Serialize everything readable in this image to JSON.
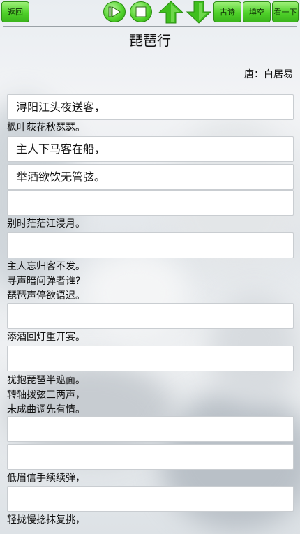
{
  "toolbar": {
    "back_label": "返回",
    "play_icon": "play-icon",
    "stop_icon": "stop-icon",
    "up_icon": "arrow-up-icon",
    "down_icon": "arrow-down-icon",
    "ancient_poem_label": "古诗",
    "fill_blank_label": "填空",
    "next_label": "看一下"
  },
  "poem": {
    "title": "琵琶行",
    "author": "唐：白居易"
  },
  "boxes": [
    "浔阳江头夜送客，",
    "主人下马客在船，",
    "举酒欲饮无管弦。",
    "",
    "",
    "",
    "",
    "",
    "",
    "",
    ""
  ],
  "lines": [
    "枫叶荻花秋瑟瑟。",
    "别时茫茫江浸月。",
    "主人忘归客不发。",
    "寻声暗问弹者谁?",
    "琵琶声停欲语迟。",
    "添酒回灯重开宴。",
    "犹抱琵琶半遮面。",
    "转轴拨弦三两声，",
    "未成曲调先有情。",
    "低眉信手续续弹，",
    "轻拢慢捻抹复挑，"
  ],
  "colors": {
    "button_green": "#4fd12a",
    "arrow_green": "#3fbf1e"
  }
}
